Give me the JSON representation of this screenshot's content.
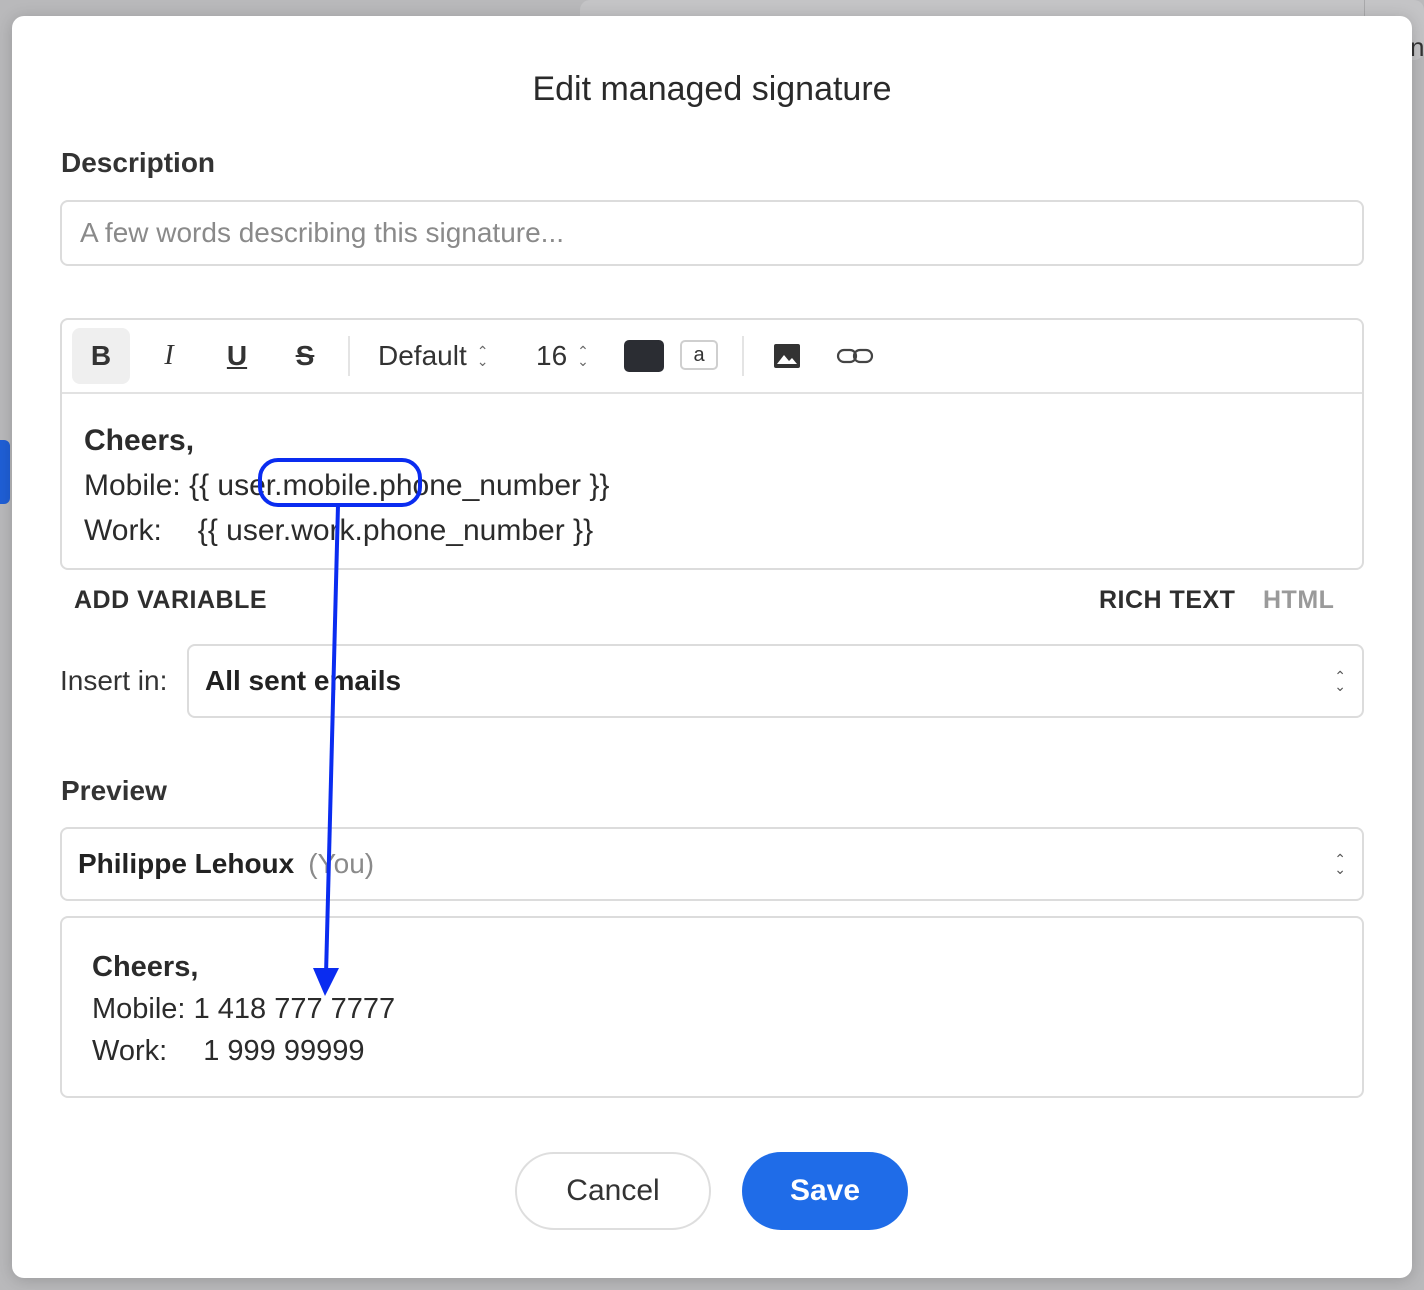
{
  "modal": {
    "title": "Edit managed signature"
  },
  "description": {
    "label": "Description",
    "placeholder": "A few words describing this signature...",
    "value": ""
  },
  "toolbar": {
    "bold": "B",
    "italic": "I",
    "underline": "U",
    "strikethrough": "S",
    "font_family": "Default",
    "font_size": "16",
    "highlight_glyph": "a",
    "text_color": "#2b2d33",
    "icons": [
      "image-icon",
      "link-icon"
    ]
  },
  "editor": {
    "line1": "Cheers,",
    "line2_label": "Mobile:",
    "line2_var": "{{ user.mobile.phone_number }}",
    "line3_label": "Work:",
    "line3_var": "{{ user.work.phone_number }}"
  },
  "editor_footer": {
    "add_variable": "ADD VARIABLE",
    "rich_text": "RICH TEXT",
    "html": "HTML"
  },
  "insert_in": {
    "label": "Insert in:",
    "value": "All sent emails"
  },
  "preview": {
    "label": "Preview",
    "user_name": "Philippe Lehoux",
    "user_suffix": "(You)",
    "line1": "Cheers,",
    "line2_label": "Mobile:",
    "line2_value": "1 418 777 7777",
    "line3_label": "Work:",
    "line3_value": "1 999 99999"
  },
  "buttons": {
    "cancel": "Cancel",
    "save": "Save"
  },
  "annotation": {
    "color": "#0a2cf0"
  }
}
